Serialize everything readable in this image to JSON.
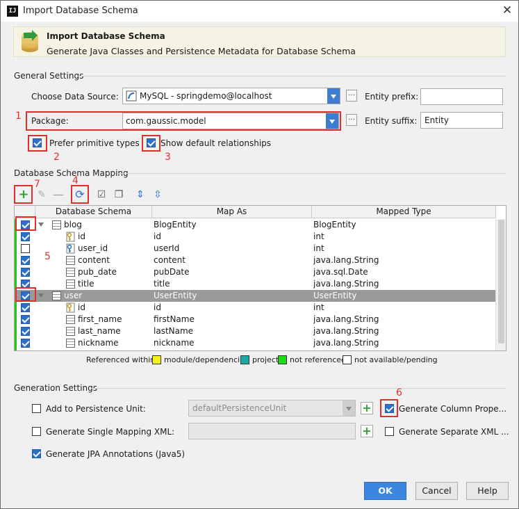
{
  "window": {
    "title": "Import Database Schema",
    "logo_text": "IJ"
  },
  "banner": {
    "title": "Import Database Schema",
    "subtitle": "Generate Java Classes and Persistence Metadata for Database Schema"
  },
  "general": {
    "section": "General Settings",
    "datasource_label": "Choose Data Source:",
    "datasource_value": "MySQL - springdemo@localhost",
    "entity_prefix_label": "Entity prefix:",
    "entity_prefix_value": "",
    "package_label": "Package:",
    "package_value": "com.gaussic.model",
    "entity_suffix_label": "Entity suffix:",
    "entity_suffix_value": "Entity",
    "prefer_primitive": "Prefer primitive types",
    "show_default_rel": "Show default relationships"
  },
  "mapping": {
    "section": "Database Schema Mapping",
    "columns": [
      "Database Schema",
      "Map As",
      "Mapped Type"
    ],
    "rows": [
      {
        "name": "blog",
        "map": "BlogEntity",
        "type": "BlogEntity",
        "kind": "table",
        "checked": true
      },
      {
        "name": "id",
        "map": "id",
        "type": "int",
        "kind": "key",
        "checked": true
      },
      {
        "name": "user_id",
        "map": "userId",
        "type": "int",
        "kind": "fkey",
        "checked": false
      },
      {
        "name": "content",
        "map": "content",
        "type": "java.lang.String",
        "kind": "col",
        "checked": true
      },
      {
        "name": "pub_date",
        "map": "pubDate",
        "type": "java.sql.Date",
        "kind": "col",
        "checked": true
      },
      {
        "name": "title",
        "map": "title",
        "type": "java.lang.String",
        "kind": "col",
        "checked": true
      },
      {
        "name": "user",
        "map": "UserEntity",
        "type": "UserEntity",
        "kind": "table",
        "checked": true
      },
      {
        "name": "id",
        "map": "id",
        "type": "int",
        "kind": "key",
        "checked": true
      },
      {
        "name": "first_name",
        "map": "firstName",
        "type": "java.lang.String",
        "kind": "col",
        "checked": true
      },
      {
        "name": "last_name",
        "map": "lastName",
        "type": "java.lang.String",
        "kind": "col",
        "checked": true
      },
      {
        "name": "nickname",
        "map": "nickname",
        "type": "java.lang.String",
        "kind": "col",
        "checked": true
      }
    ],
    "legend": {
      "prefix": "Referenced within:",
      "items": [
        {
          "label": "module/dependencies",
          "color": "#f5f01e"
        },
        {
          "label": "project",
          "color": "#1fa6a6"
        },
        {
          "label": "not referenced",
          "color": "#23d81b"
        },
        {
          "label": "not available/pending",
          "color": "#ffffff"
        }
      ]
    }
  },
  "generation": {
    "section": "Generation Settings",
    "add_persistence": "Add to Persistence Unit:",
    "persistence_value": "defaultPersistenceUnit",
    "gen_column_props": "Generate Column Prope...",
    "gen_single_xml": "Generate Single Mapping XML:",
    "gen_separate_xml": "Generate Separate XML ...",
    "gen_jpa": "Generate JPA Annotations (Java5)"
  },
  "annotations": [
    "1",
    "2",
    "3",
    "4",
    "5",
    "6",
    "7"
  ],
  "buttons": {
    "ok": "OK",
    "cancel": "Cancel",
    "help": "Help"
  },
  "colors": {
    "accent": "#3d7cd1",
    "highlight": "#e0302e",
    "not_referenced": "#23c81b"
  }
}
